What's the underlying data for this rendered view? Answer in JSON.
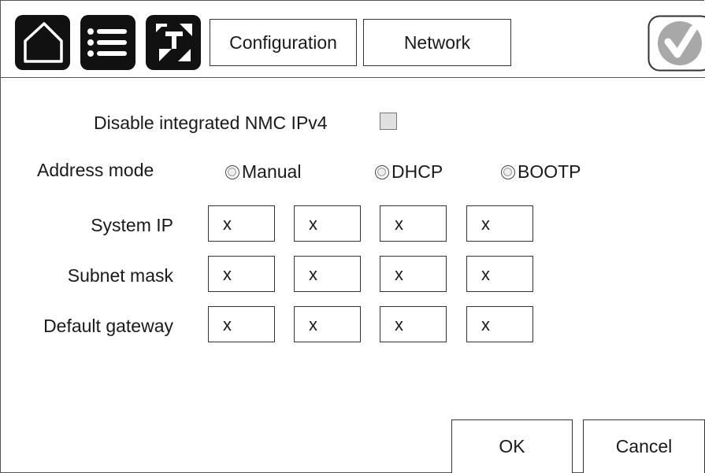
{
  "header": {
    "tabs": [
      {
        "label": "Configuration"
      },
      {
        "label": "Network"
      }
    ],
    "icons": [
      "home-icon",
      "menu-icon",
      "network-icon",
      "status-ok-icon"
    ]
  },
  "form": {
    "disable_nmc_label": "Disable integrated NMC IPv4",
    "address_mode_label": "Address mode",
    "address_modes": [
      "Manual",
      "DHCP",
      "BOOTP"
    ],
    "fields": [
      {
        "label": "System IP",
        "octets": [
          "x",
          "x",
          "x",
          "x"
        ]
      },
      {
        "label": "Subnet mask",
        "octets": [
          "x",
          "x",
          "x",
          "x"
        ]
      },
      {
        "label": "Default gateway",
        "octets": [
          "x",
          "x",
          "x",
          "x"
        ]
      }
    ]
  },
  "footer": {
    "ok_label": "OK",
    "cancel_label": "Cancel"
  },
  "colors": {
    "nav_bg": "#111111",
    "status_ok": "#a8a8a8"
  }
}
